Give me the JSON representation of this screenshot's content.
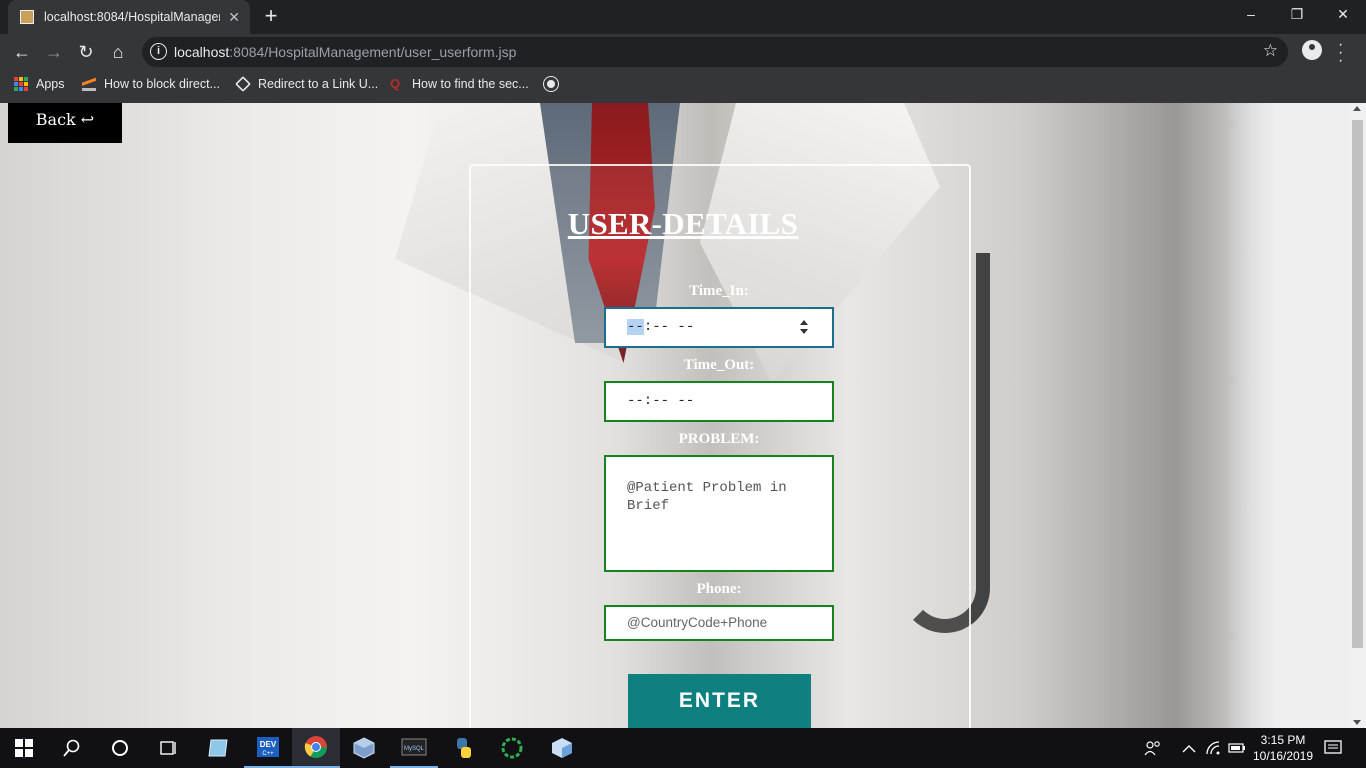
{
  "browser": {
    "tab_title": "localhost:8084/HospitalManagem",
    "tab_close": "✕",
    "new_tab": "+",
    "url_host": "localhost",
    "url_rest": ":8084/HospitalManagement/user_userform.jsp",
    "window_controls": {
      "minimize": "–",
      "maximize": "❐",
      "close": "✕"
    }
  },
  "bookmarks": [
    {
      "label": "Apps",
      "icon": "apps-grid-icon"
    },
    {
      "label": "How to block direct...",
      "icon": "stackoverflow-icon"
    },
    {
      "label": "Redirect to a Link U...",
      "icon": "codepen-icon"
    },
    {
      "label": "How to find the sec...",
      "icon": "quora-icon"
    },
    {
      "label": "",
      "icon": "globe-icon"
    }
  ],
  "page": {
    "back_label": "Back ↩",
    "form_title": "USER-DETAILS",
    "fields": {
      "time_in": {
        "label": "Time_In:",
        "value_selected": "--",
        "value_rest": ":-- --"
      },
      "time_out": {
        "label": "Time_Out:",
        "value": "--:-- --"
      },
      "problem": {
        "label": "PROBLEM:",
        "placeholder": "@Patient Problem in Brief"
      },
      "phone": {
        "label": "Phone:",
        "placeholder": "@CountryCode+Phone"
      }
    },
    "submit_label": "ENTER"
  },
  "taskbar": {
    "time": "3:15 PM",
    "date": "10/16/2019",
    "apps": [
      "windows-start-icon",
      "search-icon",
      "cortana-icon",
      "task-view-icon",
      "app-icon",
      "dev-icon",
      "chrome-icon",
      "virtualbox-icon",
      "mysql-icon",
      "python-icon",
      "loading-ring-icon",
      "cube-icon"
    ]
  }
}
